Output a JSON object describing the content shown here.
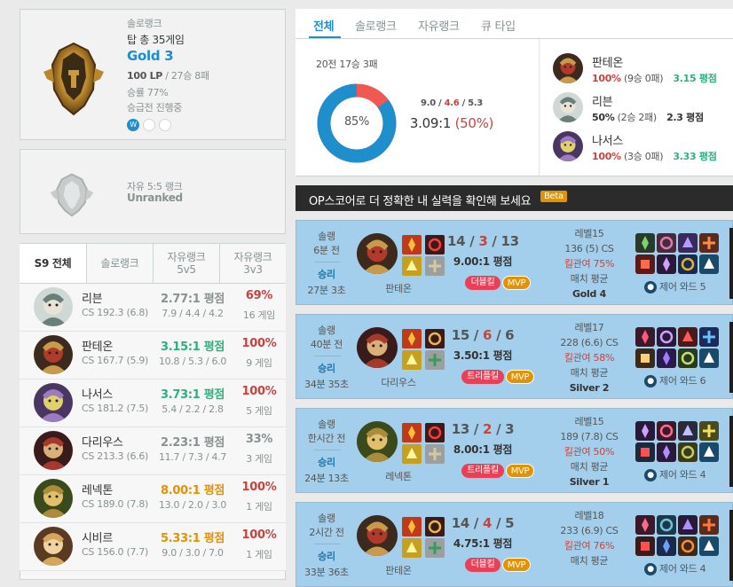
{
  "solo": {
    "label": "솔로랭크",
    "position": "탑 총 35게임",
    "tier": "Gold 3",
    "lp": "100 LP",
    "record": " / 27승 8패",
    "winrate": "승률 77%",
    "promo": "승급전 진행중",
    "promo_mark": "W"
  },
  "flex": {
    "label": "자유 5:5 랭크",
    "tier": "Unranked"
  },
  "champ_tabs": [
    "S9 전체",
    "솔로랭크",
    "자유랭크\n5v5",
    "자유랭크\n3v3"
  ],
  "champions": [
    {
      "name": "리븐",
      "cs": "CS 192.3 (6.8)",
      "kda": "2.77:1 평점",
      "kda_color": "#879292",
      "detail": "7.9 / 4.4 / 4.2",
      "wr": "69%",
      "wr_color": "#c6443e",
      "games": "16 게임"
    },
    {
      "name": "판테온",
      "cs": "CS 167.7 (5.9)",
      "kda": "3.15:1 평점",
      "kda_color": "#2daf7f",
      "detail": "10.8 / 5.3 / 6.0",
      "wr": "100%",
      "wr_color": "#c6443e",
      "games": "9 게임"
    },
    {
      "name": "나서스",
      "cs": "CS 181.2 (7.5)",
      "kda": "3.73:1 평점",
      "kda_color": "#2daf7f",
      "detail": "5.4 / 2.2 / 2.8",
      "wr": "100%",
      "wr_color": "#c6443e",
      "games": "5 게임"
    },
    {
      "name": "다리우스",
      "cs": "CS 213.3 (6.6)",
      "kda": "2.23:1 평점",
      "kda_color": "#879292",
      "detail": "11.7 / 7.3 / 4.7",
      "wr": "33%",
      "wr_color": "#879292",
      "games": "3 게임"
    },
    {
      "name": "레넥톤",
      "cs": "CS 189.0 (7.8)",
      "kda": "8.00:1 평점",
      "kda_color": "#e19205",
      "detail": "13.0 / 2.0 / 3.0",
      "wr": "100%",
      "wr_color": "#c6443e",
      "games": "1 게임"
    },
    {
      "name": "시비르",
      "cs": "CS 156.0 (7.7)",
      "kda": "5.33:1 평점",
      "kda_color": "#e19205",
      "detail": "9.0 / 3.0 / 7.0",
      "wr": "100%",
      "wr_color": "#c6443e",
      "games": "1 게임"
    }
  ],
  "right_tabs": [
    "전체",
    "솔로랭크",
    "자유랭크",
    "큐 타입"
  ],
  "summary": {
    "record": "20전 17승 3패",
    "win_pct": "85%",
    "win_ratio": 0.85,
    "kills": "9.0",
    "deaths": "4.6",
    "assists": "5.3",
    "kda": "3.09:1",
    "kp": "(50%)"
  },
  "recent_champs": [
    {
      "name": "판테온",
      "wr": "100%",
      "wl": " (9승 0패)",
      "kda": "3.15 평점",
      "kda_color": "#2daf7f",
      "wr_color": "#c6443e"
    },
    {
      "name": "리븐",
      "wr": "50%",
      "wl": " (2승 2패)",
      "kda": "2.3 평점",
      "kda_color": "#333",
      "wr_color": "#333"
    },
    {
      "name": "나서스",
      "wr": "100%",
      "wl": " (3승 0패)",
      "kda": "3.33 평점",
      "kda_color": "#2daf7f",
      "wr_color": "#c6443e"
    }
  ],
  "banner": {
    "text": "OP스코어로 더 정확한 내 실력을 확인해 보세요",
    "badge": "Beta"
  },
  "games": [
    {
      "type": "솔랭",
      "ago": "6분 전",
      "result": "승리",
      "duration": "27분 3초",
      "champ": "판테온",
      "k": "14",
      "d": "3",
      "a": "13",
      "ratio": "9.00:1 평점",
      "multikill": "더블킬",
      "mvp": "MVP",
      "level": "레벨15",
      "cs": "136 (5) CS",
      "kp": "킬관여 75%",
      "match": "매치 평균",
      "avg": "Gold 4",
      "ward": "제어 와드 5"
    },
    {
      "type": "솔랭",
      "ago": "40분 전",
      "result": "승리",
      "duration": "34분 35초",
      "champ": "다리우스",
      "k": "15",
      "d": "6",
      "a": "6",
      "ratio": "3.50:1 평점",
      "multikill": "트리플킬",
      "mvp": "MVP",
      "level": "레벨17",
      "cs": "228 (6.6) CS",
      "kp": "킬관여 58%",
      "match": "매치 평균",
      "avg": "Silver 2",
      "ward": "제어 와드 6"
    },
    {
      "type": "솔랭",
      "ago": "한시간 전",
      "result": "승리",
      "duration": "24분 13초",
      "champ": "레넥톤",
      "k": "13",
      "d": "2",
      "a": "3",
      "ratio": "8.00:1 평점",
      "multikill": "트리플킬",
      "mvp": "MVP",
      "level": "레벨15",
      "cs": "189 (7.8) CS",
      "kp": "킬관여 50%",
      "match": "매치 평균",
      "avg": "Silver 1",
      "ward": "제어 와드 4"
    },
    {
      "type": "솔랭",
      "ago": "2시간 전",
      "result": "승리",
      "duration": "33분 36초",
      "champ": "판테온",
      "k": "14",
      "d": "4",
      "a": "5",
      "ratio": "4.75:1 평점",
      "multikill": "더블킬",
      "mvp": "MVP",
      "level": "레벨18",
      "cs": "233 (6.9) CS",
      "kp": "킬관여 76%",
      "match": "매치 평균",
      "avg": "",
      "ward": "제어 와드 4"
    }
  ],
  "colors": {
    "win_bg": "#a3cfec",
    "accent": "#1f8ecd",
    "loss": "#ee5a52",
    "gold": "#1f8ecd",
    "multikill": "#e84057",
    "mvp": "#e19205"
  }
}
